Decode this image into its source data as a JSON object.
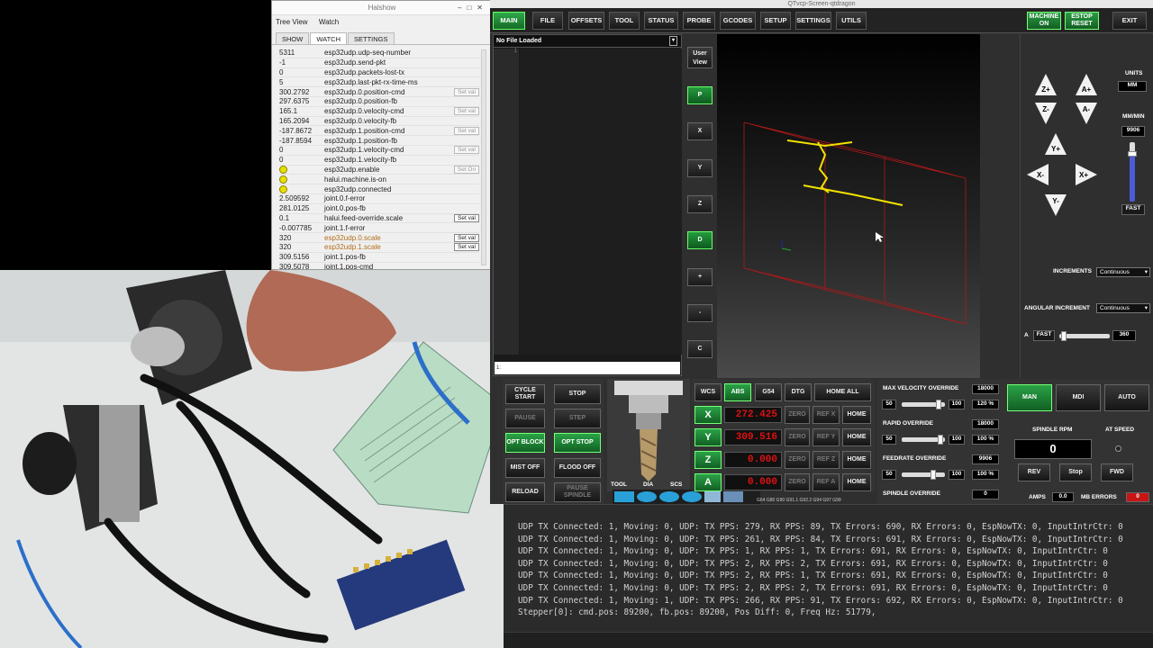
{
  "halshow": {
    "title": "Halshow",
    "menu": [
      "Tree View",
      "Watch"
    ],
    "tabs": [
      "SHOW",
      "WATCH",
      "SETTINGS"
    ],
    "active_tab": "WATCH",
    "rows": [
      {
        "value": "5311",
        "name": "esp32udp.udp-seq-number",
        "button": ""
      },
      {
        "value": "-1",
        "name": "esp32udp.send-pkt",
        "button": ""
      },
      {
        "value": "0",
        "name": "esp32udp.packets-lost-tx",
        "button": ""
      },
      {
        "value": "5",
        "name": "esp32udp.last-pkt-rx-time-ms",
        "button": ""
      },
      {
        "value": "300.2792",
        "name": "esp32udp.0.position-cmd",
        "button": "Set val"
      },
      {
        "value": "297.6375",
        "name": "esp32udp.0.position-fb",
        "button": ""
      },
      {
        "value": "165.1",
        "name": "esp32udp.0.velocity-cmd",
        "button": "Set val"
      },
      {
        "value": "165.2094",
        "name": "esp32udp.0.velocity-fb",
        "button": ""
      },
      {
        "value": "-187.8672",
        "name": "esp32udp.1.position-cmd",
        "button": "Set val"
      },
      {
        "value": "-187.8594",
        "name": "esp32udp.1.position-fb",
        "button": ""
      },
      {
        "value": "0",
        "name": "esp32udp.1.velocity-cmd",
        "button": "Set val"
      },
      {
        "value": "0",
        "name": "esp32udp.1.velocity-fb",
        "button": ""
      },
      {
        "value": "",
        "name": "esp32udp.enable",
        "button": "Set On",
        "led": true
      },
      {
        "value": "",
        "name": "halui.machine.is-on",
        "button": "",
        "led": true
      },
      {
        "value": "",
        "name": "esp32udp.connected",
        "button": "",
        "led": true
      },
      {
        "value": "2.509592",
        "name": "joint.0.f-error",
        "button": ""
      },
      {
        "value": "281.0125",
        "name": "joint.0.pos-fb",
        "button": ""
      },
      {
        "value": "0.1",
        "name": "halui.feed-override.scale",
        "button": "Set val",
        "active": true
      },
      {
        "value": "-0.007785",
        "name": "joint.1.f-error",
        "button": ""
      },
      {
        "value": "320",
        "name": "esp32udp.0.scale",
        "button": "Set val",
        "active": true,
        "orange": true
      },
      {
        "value": "320",
        "name": "esp32udp.1.scale",
        "button": "Set val",
        "active": true,
        "orange": true
      },
      {
        "value": "309.5156",
        "name": "joint.1.pos-fb",
        "button": ""
      },
      {
        "value": "309.5078",
        "name": "joint.1.pos-cmd",
        "button": ""
      }
    ]
  },
  "qtvcp": {
    "title": "QTvcp-Screen-qtdragon",
    "tabs": [
      "MAIN",
      "FILE",
      "OFFSETS",
      "TOOL",
      "STATUS",
      "PROBE",
      "GCODES",
      "SETUP",
      "SETTINGS",
      "UTILS"
    ],
    "active_tab": "MAIN",
    "machine_on": "MACHINE ON",
    "estop": "ESTOP RESET",
    "exit": "EXIT",
    "file_label": "No File Loaded",
    "gutter_first_line": "1",
    "mdi_prompt": "1:",
    "view_buttons": [
      "User View",
      "P",
      "X",
      "Y",
      "Z",
      "D",
      "+",
      "-",
      "C"
    ],
    "jog": {
      "z_plus": "Z+",
      "z_minus": "Z-",
      "a_plus": "A+",
      "a_minus": "A-",
      "y_plus": "Y+",
      "y_minus": "Y-",
      "x_plus": "X+",
      "x_minus": "X-",
      "units_label": "UNITS",
      "units_value": "MM",
      "rate_label": "MM/MIN",
      "rate_value": "9906",
      "fast_label": "FAST",
      "increments_label": "INCREMENTS",
      "increments_value": "Continuous",
      "angular_label": "ANGULAR INCREMENT",
      "angular_value": "Continuous",
      "a_label": "A",
      "a_fast": "FAST",
      "a_value": "360"
    },
    "cycle": {
      "cycle_start": "CYCLE START",
      "stop": "STOP",
      "pause": "PAUSE",
      "step": "STEP",
      "opt_block": "OPT BLOCK",
      "opt_stop": "OPT STOP",
      "mist_off": "MIST OFF",
      "flood_off": "FLOOD OFF",
      "reload": "RELOAD",
      "pause_spindle": "PAUSE SPINDLE"
    },
    "tool_labels": [
      "TOOL",
      "DIA",
      "SCS"
    ],
    "dro": {
      "header": [
        "WCS",
        "ABS",
        "G54",
        "DTG",
        "HOME ALL"
      ],
      "axes": [
        {
          "axis": "X",
          "value": "272.425",
          "zero": "ZERO",
          "ref": "REF X",
          "home": "HOME"
        },
        {
          "axis": "Y",
          "value": "309.516",
          "zero": "ZERO",
          "ref": "REF Y",
          "home": "HOME"
        },
        {
          "axis": "Z",
          "value": "0.000",
          "zero": "ZERO",
          "ref": "REF Z",
          "home": "HOME"
        },
        {
          "axis": "A",
          "value": "0.000",
          "zero": "ZERO",
          "ref": "REF A",
          "home": "HOME"
        }
      ],
      "gcodes_line": "G64 G80 G90 G91.1 G92.2 G94 G97 G99"
    },
    "overrides": [
      {
        "label": "MAX VELOCITY OVERRIDE",
        "max": "18000",
        "left": "50",
        "right": "100",
        "pct": "120 %",
        "level": 0.9
      },
      {
        "label": "RAPID OVERRIDE",
        "max": "18000",
        "left": "50",
        "right": "100",
        "pct": "100 %",
        "level": 0.95
      },
      {
        "label": "FEEDRATE OVERRIDE",
        "max": "9906",
        "left": "50",
        "right": "100",
        "pct": "100 %",
        "level": 0.75
      },
      {
        "label": "SPINDLE OVERRIDE",
        "max": "0",
        "left": "",
        "right": "",
        "pct": "",
        "level": 0
      }
    ],
    "modes": [
      "MAN",
      "MDI",
      "AUTO"
    ],
    "active_mode": "MAN",
    "spindle": {
      "rpm_label": "SPINDLE RPM",
      "at_speed_label": "AT SPEED",
      "rpm_value": "0",
      "rev": "REV",
      "stop": "Stop",
      "fwd": "FWD",
      "amps_label": "AMPS",
      "amps_value": "0.0",
      "mb_errors_label": "MB ERRORS",
      "mb_errors_value": "0"
    }
  },
  "console": {
    "lines": [
      "UDP TX Connected: 1, Moving: 0, UDP: TX PPS: 279, RX PPS: 89, TX Errors: 690, RX Errors: 0, EspNowTX: 0, InputIntrCtr: 0",
      "UDP TX Connected: 1, Moving: 0, UDP: TX PPS: 261, RX PPS: 84, TX Errors: 691, RX Errors: 0, EspNowTX: 0, InputIntrCtr: 0",
      "UDP TX Connected: 1, Moving: 0, UDP: TX PPS: 1, RX PPS: 1, TX Errors: 691, RX Errors: 0, EspNowTX: 0, InputIntrCtr: 0",
      "UDP TX Connected: 1, Moving: 0, UDP: TX PPS: 2, RX PPS: 2, TX Errors: 691, RX Errors: 0, EspNowTX: 0, InputIntrCtr: 0",
      "UDP TX Connected: 1, Moving: 0, UDP: TX PPS: 2, RX PPS: 1, TX Errors: 691, RX Errors: 0, EspNowTX: 0, InputIntrCtr: 0",
      "UDP TX Connected: 1, Moving: 0, UDP: TX PPS: 2, RX PPS: 2, TX Errors: 691, RX Errors: 0, EspNowTX: 0, InputIntrCtr: 0",
      "UDP TX Connected: 1, Moving: 1, UDP: TX PPS: 266, RX PPS: 91, TX Errors: 692, RX Errors: 0, EspNowTX: 0, InputIntrCtr: 0",
      "Stepper[0]: cmd.pos: 89200, fb.pos: 89200, Pos Diff: 0, Freq Hz: 51779,"
    ]
  },
  "colors": {
    "accent_green": "#2aa246",
    "dro_red": "#e01010",
    "toolpath_yellow": "#f2e200",
    "limits_red": "#b01818"
  }
}
